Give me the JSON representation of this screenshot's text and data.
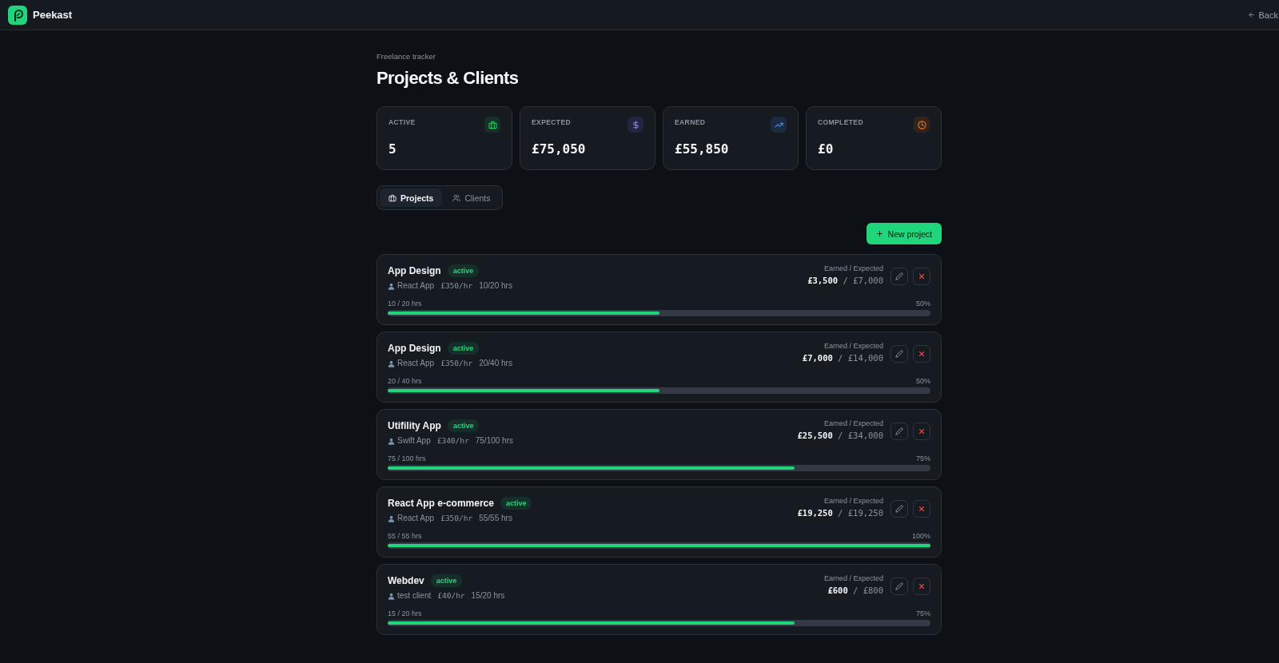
{
  "header": {
    "brand": "Peekast",
    "back": "Back"
  },
  "page": {
    "eyebrow": "Freelance tracker",
    "title": "Projects & Clients"
  },
  "stats": [
    {
      "label": "ACTIVE",
      "value": "5"
    },
    {
      "label": "EXPECTED",
      "value": "£75,050"
    },
    {
      "label": "EARNED",
      "value": "£55,850"
    },
    {
      "label": "COMPLETED",
      "value": "£0"
    }
  ],
  "tabs": [
    {
      "label": "Projects",
      "selected": true
    },
    {
      "label": "Clients",
      "selected": false
    }
  ],
  "new_project_button": "New project",
  "projects": [
    {
      "title": "App Design",
      "status": "active",
      "client": "React App",
      "rate": "£350/hr",
      "hours": "10/20 hrs",
      "amounts_label": "Earned / Expected",
      "amounts": "**£3,500** / £7,000",
      "progress_label": "10 / 20 hrs",
      "percent": "50%",
      "level": 0.5
    },
    {
      "title": "App Design",
      "status": "active",
      "client": "React App",
      "rate": "£350/hr",
      "hours": "20/40 hrs",
      "amounts_label": "Earned / Expected",
      "amounts": "**£7,000** / £14,000",
      "progress_label": "20 / 40 hrs",
      "percent": "50%",
      "level": 0.5
    },
    {
      "title": "Utifility App",
      "status": "active",
      "client": "Swift App",
      "rate": "£340/hr",
      "hours": "75/100 hrs",
      "amounts_label": "Earned / Expected",
      "amounts": "**£25,500** / £34,000",
      "progress_label": "75 / 100 hrs",
      "percent": "75%",
      "level": 0.75
    },
    {
      "title": "React App e-commerce",
      "status": "active",
      "client": "React App",
      "rate": "£350/hr",
      "hours": "55/55 hrs",
      "amounts_label": "Earned / Expected",
      "amounts": "**£19,250** / £19,250",
      "progress_label": "55 / 55 hrs",
      "percent": "100%",
      "level": 1
    },
    {
      "title": "Webdev",
      "status": "active",
      "client": "test client",
      "rate": "£40/hr",
      "hours": "15/20 hrs",
      "amounts_label": "Earned / Expected",
      "amounts": "**£600** / £800",
      "progress_label": "15 / 20 hrs",
      "percent": "75%",
      "level": 0.75
    }
  ]
}
